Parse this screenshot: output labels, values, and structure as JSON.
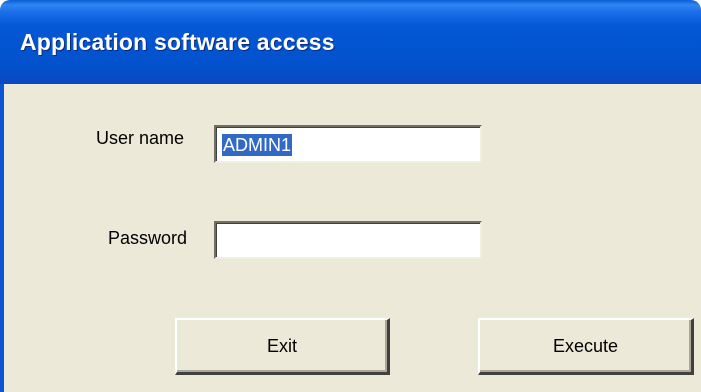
{
  "window": {
    "title": "Application software access"
  },
  "form": {
    "username_label": "User name",
    "username_value": "ADMIN1",
    "password_label": "Password",
    "password_value": ""
  },
  "buttons": {
    "exit_label": "Exit",
    "execute_label": "Execute"
  },
  "colors": {
    "titlebar": "#0254d0",
    "dialog_background": "#ece9d8",
    "selection": "#316ac5"
  }
}
